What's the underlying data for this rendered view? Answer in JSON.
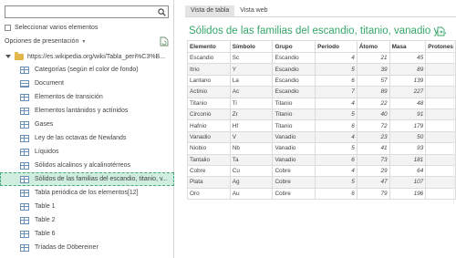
{
  "search": {
    "value": "",
    "placeholder": ""
  },
  "select_multiple_label": "Seleccionar varios elementos",
  "display_options_label": "Opciones de presentación",
  "root_url": "https://es.wikipedia.org/wiki/Tabla_peri%C3%B...",
  "items": [
    {
      "label": "Categorías (según el color de fondo)",
      "icon": "table-icon"
    },
    {
      "label": "Document",
      "icon": "document-icon"
    },
    {
      "label": "Elementos de transición",
      "icon": "table-icon"
    },
    {
      "label": "Elementos lantánidos y actínidos",
      "icon": "table-icon"
    },
    {
      "label": "Gases",
      "icon": "table-icon"
    },
    {
      "label": "Ley de las octavas de Newlands",
      "icon": "table-icon"
    },
    {
      "label": "Líquidos",
      "icon": "table-icon"
    },
    {
      "label": "Sólidos alcalinos y alcalinotérreos",
      "icon": "table-icon"
    },
    {
      "label": "Sólidos de las familias del escandio, titanio, v...",
      "icon": "table-icon",
      "selected": true
    },
    {
      "label": "Tabla periódica de los elementos[12]",
      "icon": "table-icon"
    },
    {
      "label": "Table 1",
      "icon": "table-icon"
    },
    {
      "label": "Table 2",
      "icon": "table-icon"
    },
    {
      "label": "Table 6",
      "icon": "table-icon"
    },
    {
      "label": "Tríadas de Döbereiner",
      "icon": "table-icon"
    }
  ],
  "tabs": [
    "Vista de tabla",
    "Vista web"
  ],
  "preview_title": "Sólidos de las familias del escandio, titanio, vanadio y...",
  "columns": [
    "Elemento",
    "Símbolo",
    "Grupo",
    "Periodo",
    "Átomo",
    "Masa",
    "Protones"
  ],
  "rows": [
    [
      "Escandio",
      "Sc",
      "Escandio",
      "4",
      "21",
      "45",
      ""
    ],
    [
      "Itrio",
      "Y",
      "Escandio",
      "5",
      "39",
      "89",
      ""
    ],
    [
      "Lantano",
      "La",
      "Escandio",
      "6",
      "57",
      "139",
      ""
    ],
    [
      "Actinio",
      "Ac",
      "Escandio",
      "7",
      "89",
      "227",
      ""
    ],
    [
      "Titanio",
      "Ti",
      "Titanio",
      "4",
      "22",
      "48",
      ""
    ],
    [
      "Circonio",
      "Zr",
      "Titanio",
      "5",
      "40",
      "91",
      ""
    ],
    [
      "Hafnio",
      "Hf",
      "Titanio",
      "6",
      "72",
      "179",
      ""
    ],
    [
      "Vanadio",
      "V",
      "Vanadio",
      "4",
      "23",
      "50",
      ""
    ],
    [
      "Niobio",
      "Nb",
      "Vanadio",
      "5",
      "41",
      "93",
      ""
    ],
    [
      "Tantalio",
      "Ta",
      "Vanadio",
      "6",
      "73",
      "181",
      ""
    ],
    [
      "Cobre",
      "Cu",
      "Cobre",
      "4",
      "29",
      "64",
      ""
    ],
    [
      "Plata",
      "Ag",
      "Cobre",
      "5",
      "47",
      "107",
      ""
    ],
    [
      "Oro",
      "Au",
      "Cobre",
      "6",
      "79",
      "196",
      ""
    ]
  ],
  "colors": {
    "accent": "#36a56a",
    "selected_bg": "#cfeee0",
    "folder": "#e2b64a"
  }
}
